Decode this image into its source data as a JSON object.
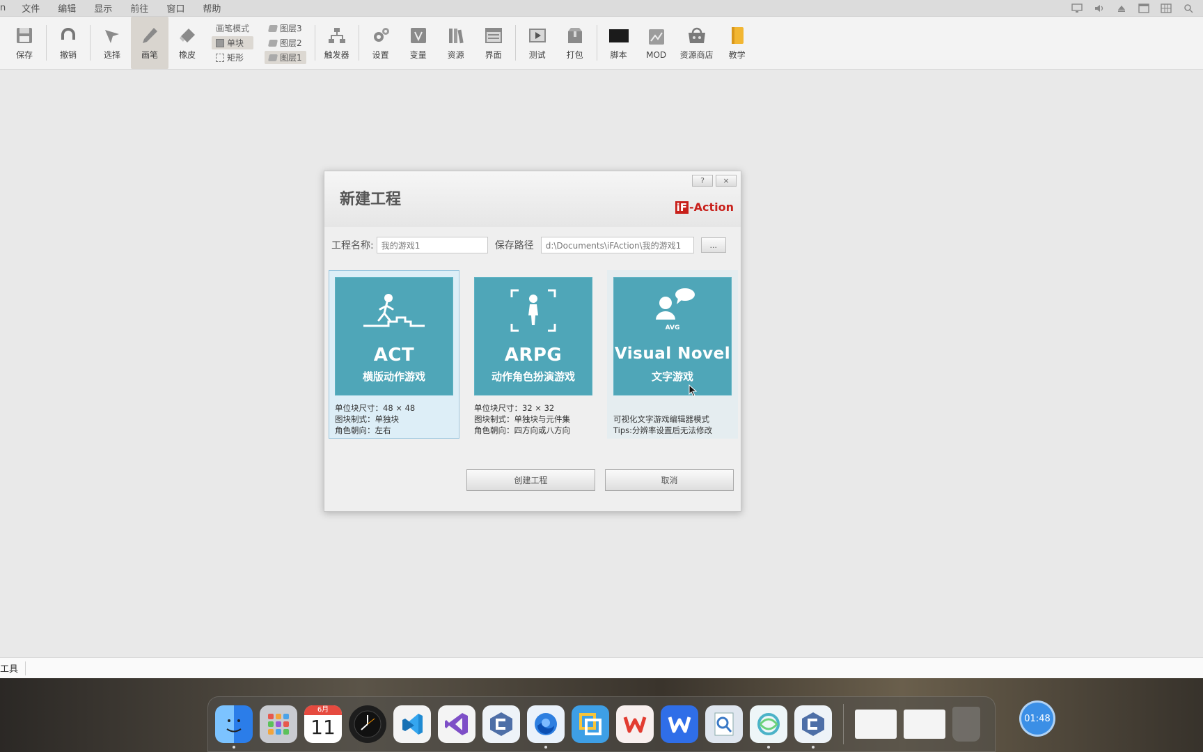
{
  "menubar": {
    "items": [
      "n",
      "文件",
      "编辑",
      "显示",
      "前往",
      "窗口",
      "帮助"
    ],
    "tray_icons": [
      "monitor-icon",
      "speaker-icon",
      "eject-icon",
      "window-icon",
      "grid-icon",
      "search-icon"
    ]
  },
  "toolbar": {
    "save": "保存",
    "undo": "撤销",
    "select": "选择",
    "pen": "画笔",
    "eraser": "橡皮",
    "pen_mode_title": "画笔模式",
    "pen_mode_single": "单块",
    "pen_mode_rect": "矩形",
    "layer3": "图层3",
    "layer2": "图层2",
    "layer1": "图层1",
    "trigger": "触发器",
    "settings": "设置",
    "variables": "变量",
    "resources": "资源",
    "interface": "界面",
    "test": "测试",
    "package": "打包",
    "script": "脚本",
    "mod": "MOD",
    "store": "资源商店",
    "tutorial": "教学"
  },
  "dialog": {
    "title": "新建工程",
    "help_btn": "?",
    "close_btn": "×",
    "brand_box": "iF",
    "brand_text": "-Action",
    "project_name_label": "工程名称:",
    "project_name_value": "我的游戏1",
    "save_path_label": "保存路径",
    "save_path_value": "d:\\Documents\\iFAction\\我的游戏1",
    "browse_btn": "...",
    "templates": [
      {
        "name": "ACT",
        "subtitle": "横版动作游戏",
        "desc": [
          "单位块尺寸：48 × 48",
          "图块制式：单独块",
          "角色朝向：左右"
        ]
      },
      {
        "name": "ARPG",
        "subtitle": "动作角色扮演游戏",
        "desc": [
          "单位块尺寸：32 × 32",
          "图块制式：单独块与元件集",
          "角色朝向：四方向或八方向"
        ]
      },
      {
        "name": "Visual Novel",
        "subtitle": "文字游戏",
        "avg_label": "AVG",
        "desc": [
          "可视化文字游戏编辑器模式",
          "Tips:分辨率设置后无法修改"
        ]
      }
    ],
    "create_btn": "创建工程",
    "cancel_btn": "取消"
  },
  "statusbar": {
    "text": "工具"
  },
  "dock": {
    "calendar_month": "6月",
    "calendar_day": "11",
    "clock_badge": "01:48"
  }
}
